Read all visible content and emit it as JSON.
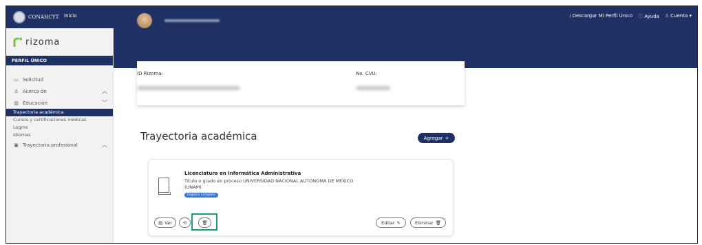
{
  "topbar": {
    "brand": "CONAHCYT",
    "inicio": "Inicio",
    "descargar": "Descargar Mi Perfil Único",
    "ayuda": "Ayuda",
    "cuenta": "Cuenta"
  },
  "sidebar": {
    "logo": "rizoma",
    "section": "PERFIL ÚNICO",
    "items": [
      {
        "label": "Solicitud",
        "icon": "document-icon"
      },
      {
        "label": "Acerca de",
        "icon": "person-icon"
      },
      {
        "label": "Educación",
        "icon": "book-icon"
      }
    ],
    "subitems": [
      "Trayectoria académica",
      "Cursos y certificaciones médicas",
      "Logros",
      "Idiomas"
    ],
    "profesional": "Trayectoria profesional"
  },
  "idcard": {
    "id_label": "ID Rizoma:",
    "cvu_label": "No. CVU:"
  },
  "main": {
    "title": "Trayectoria académica",
    "agregar": "Agregar"
  },
  "record": {
    "title": "Licenciatura en Informática Administrativa",
    "desc": "Título o grado en proceso UNIVERSIDAD NACIONAL AUTONOMA DE MEXICO (UNAM)",
    "badge": "Registro completo",
    "ver": "Ver",
    "editar": "Editar",
    "eliminar": "Eliminar"
  },
  "colors": {
    "primary": "#1f3164",
    "highlight": "#16a077",
    "badge": "#3e76c9"
  }
}
